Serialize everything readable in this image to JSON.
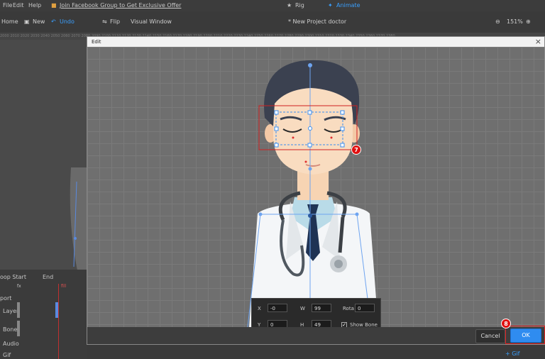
{
  "menubar": {
    "items": [
      "File",
      "Edit",
      "Help"
    ],
    "promo": "Join Facebook Group to Get Exclusive Offer",
    "mode_rig": "Rig",
    "mode_animate": "Animate"
  },
  "toolbar": {
    "home": "Home",
    "new": "New",
    "undo": "Undo",
    "flip": "Flip",
    "visual_window": "Visual Window",
    "project_title": "* New Project doctor",
    "zoom": "151%"
  },
  "ruler": "2000 2010 2020 2030 2040 2050 2060 2070 2080 2090 2100 2110 2120 2130 2140 2150 2160 2170 2180 2190 2200 2210 2220 2230 2240 2250 2260 2270 2280 2290 2300 2310 2320 2330 2340 2350 2360 2370 2380",
  "timeline": {
    "loop_start": "oop Start",
    "end": "End",
    "frame_a": "fx",
    "frame_b": "fill",
    "rows": [
      "port",
      "Layer",
      "Bone",
      "Audio",
      "Gif"
    ],
    "add_gif": "+ Gif"
  },
  "dialog": {
    "title": "Edit",
    "close": "×",
    "cancel": "Cancel",
    "ok": "OK",
    "marker7": "7",
    "marker8": "8"
  },
  "props": {
    "x_label": "X",
    "x_value": "-0",
    "w_label": "W",
    "w_value": "99",
    "rot_label": "Rota",
    "rot_value": "0",
    "y_label": "Y",
    "y_value": "0",
    "h_label": "H",
    "h_value": "49",
    "show_bone_label": "Show Bone",
    "show_bone_checked": "✓"
  }
}
